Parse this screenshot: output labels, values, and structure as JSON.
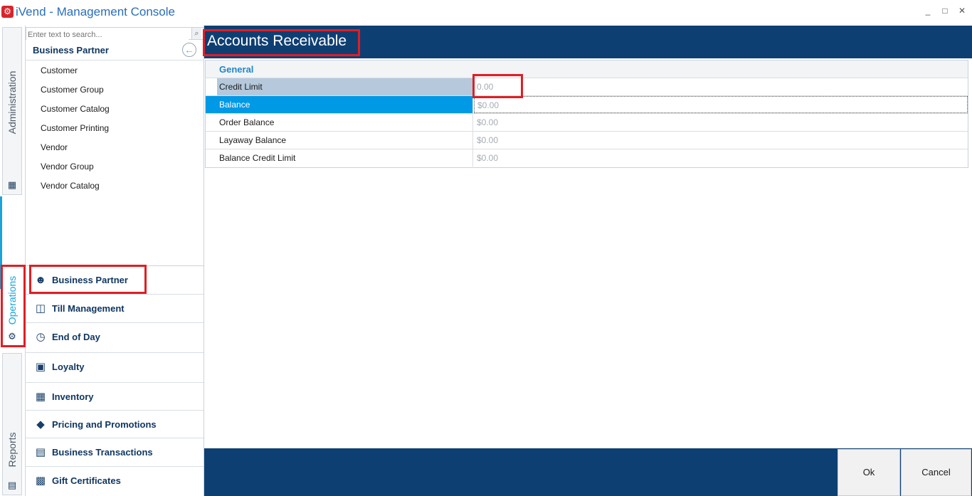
{
  "window": {
    "title": "iVend - Management Console",
    "controls": [
      "_",
      "□",
      "✕"
    ]
  },
  "rail": {
    "tabs": [
      "Administration",
      "Operations",
      "Reports"
    ]
  },
  "search": {
    "placeholder": "Enter text to search..."
  },
  "left_panel": {
    "header": "Business Partner",
    "items": [
      "Customer",
      "Customer Group",
      "Customer Catalog",
      "Customer Printing",
      "Vendor",
      "Vendor Group",
      "Vendor Catalog"
    ]
  },
  "nav": {
    "items": [
      {
        "label": "Business Partner",
        "icon": "business-partner-icon"
      },
      {
        "label": "Till Management",
        "icon": "till-icon"
      },
      {
        "label": "End of Day",
        "icon": "clock-icon"
      },
      {
        "label": "Loyalty",
        "icon": "gift-icon"
      },
      {
        "label": "Inventory",
        "icon": "warehouse-icon"
      },
      {
        "label": "Pricing and Promotions",
        "icon": "tag-icon"
      },
      {
        "label": "Business Transactions",
        "icon": "transactions-icon"
      },
      {
        "label": "Gift Certificates",
        "icon": "gift-certificate-icon"
      }
    ]
  },
  "main": {
    "title": "Accounts Receivable",
    "group": "General",
    "rows": [
      {
        "label": "Credit Limit",
        "value": "0.00"
      },
      {
        "label": "Balance",
        "value": "$0.00"
      },
      {
        "label": "Order Balance",
        "value": "$0.00"
      },
      {
        "label": "Layaway Balance",
        "value": "$0.00"
      },
      {
        "label": "Balance Credit Limit",
        "value": "$0.00"
      }
    ]
  },
  "footer": {
    "ok": "Ok",
    "cancel": "Cancel"
  },
  "colors": {
    "header_blue": "#0e3f73",
    "selection_blue": "#0099e6",
    "highlight_red": "#e01e24"
  }
}
